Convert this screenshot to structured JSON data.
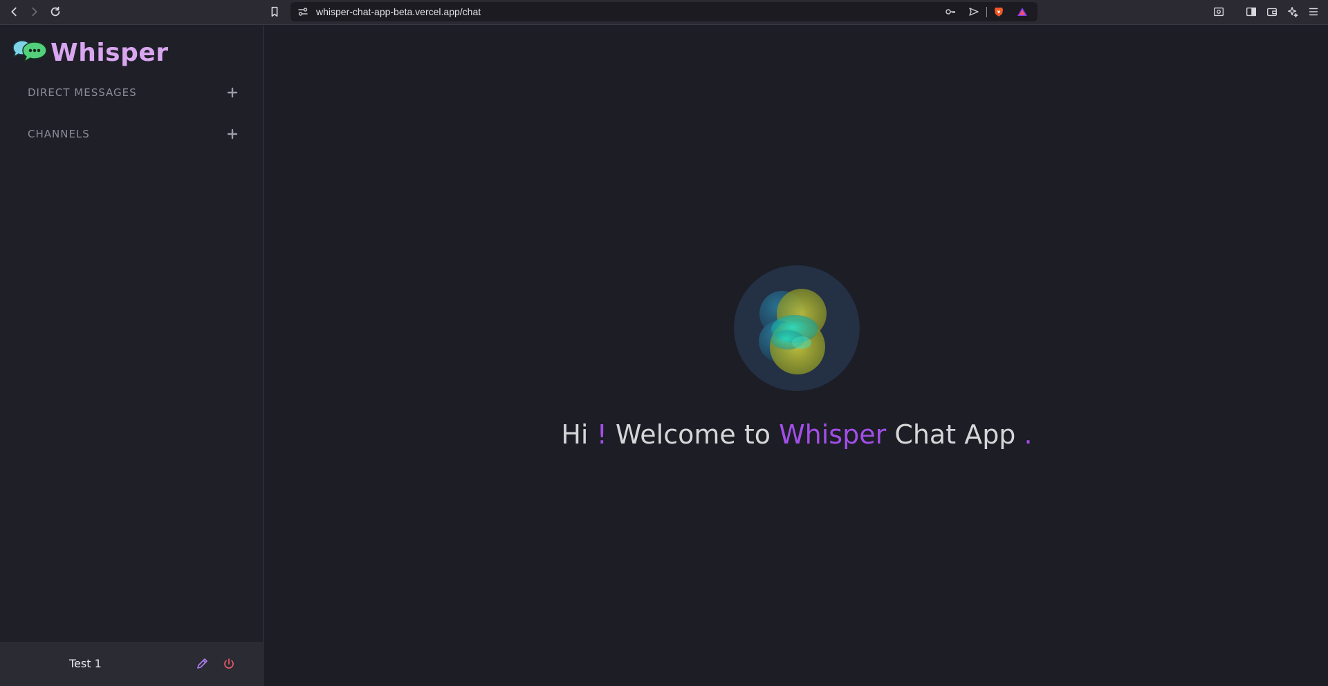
{
  "browser": {
    "url": "whisper-chat-app-beta.vercel.app/chat"
  },
  "app": {
    "logo_text": "Whisper",
    "accent_color": "#a24ee8",
    "logo_color": "#d9a6f0"
  },
  "sidebar": {
    "sections": [
      {
        "title": "DIRECT MESSAGES",
        "action_icon": "plus-icon"
      },
      {
        "title": "CHANNELS",
        "action_icon": "plus-icon"
      }
    ],
    "profile": {
      "name": "Test 1",
      "edit_icon": "pencil-icon",
      "logout_icon": "power-icon"
    }
  },
  "main": {
    "welcome": {
      "hi": "Hi",
      "bang": "!",
      "welcome_to": "Welcome to",
      "brand": "Whisper",
      "chat_app": "Chat App",
      "dot": "."
    }
  }
}
